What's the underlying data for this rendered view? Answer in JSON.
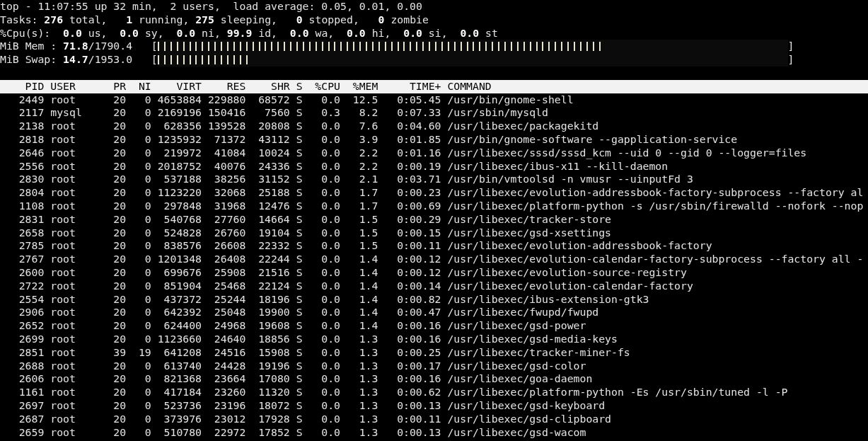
{
  "summary": {
    "uptime_line": "top - 11:07:55 up 32 min,  2 users,  load average: 0.05, 0.01, 0.00",
    "tasks_line": "Tasks: **276** total,   **1** running, **275** sleeping,   **0** stopped,   **0** zombie",
    "cpu_line": "%Cpu(s):  **0.0** us,  **0.0** sy,  **0.0** ni, **99.9** id,  **0.0** wa,  **0.0** hi,  **0.0** si,  **0.0** st",
    "meters": [
      {
        "label": "MiB Mem : **71.8**/1790.4",
        "open": "[",
        "close": "]",
        "level": 0.71
      },
      {
        "label": "MiB Swap: **14.7**/1953.0",
        "open": "[",
        "close": "]",
        "level": 0.15
      }
    ]
  },
  "table": {
    "columns": [
      "PID",
      "USER",
      "PR",
      "NI",
      "VIRT",
      "RES",
      "SHR",
      "S",
      "%CPU",
      "%MEM",
      "TIME+",
      "COMMAND"
    ],
    "rows": [
      [
        "2449",
        "root",
        "20",
        "0",
        "4653884",
        "229880",
        "68572",
        "S",
        "0.0",
        "12.5",
        "0:05.45",
        "/usr/bin/gnome-shell"
      ],
      [
        "2117",
        "mysql",
        "20",
        "0",
        "2169196",
        "150416",
        "7560",
        "S",
        "0.3",
        "8.2",
        "0:07.33",
        "/usr/sbin/mysqld"
      ],
      [
        "2138",
        "root",
        "20",
        "0",
        "628356",
        "139528",
        "20808",
        "S",
        "0.0",
        "7.6",
        "0:04.60",
        "/usr/libexec/packagekitd"
      ],
      [
        "2818",
        "root",
        "20",
        "0",
        "1235932",
        "71372",
        "43112",
        "S",
        "0.0",
        "3.9",
        "0:01.85",
        "/usr/bin/gnome-software --gapplication-service"
      ],
      [
        "2646",
        "root",
        "20",
        "0",
        "219972",
        "41084",
        "10024",
        "S",
        "0.0",
        "2.2",
        "0:01.16",
        "/usr/libexec/sssd/sssd_kcm --uid 0 --gid 0 --logger=files"
      ],
      [
        "2556",
        "root",
        "20",
        "0",
        "2018752",
        "40076",
        "24336",
        "S",
        "0.0",
        "2.2",
        "0:00.19",
        "/usr/libexec/ibus-x11 --kill-daemon"
      ],
      [
        "2830",
        "root",
        "20",
        "0",
        "537188",
        "38256",
        "31152",
        "S",
        "0.0",
        "2.1",
        "0:03.71",
        "/usr/bin/vmtoolsd -n vmusr --uinputFd 3"
      ],
      [
        "2804",
        "root",
        "20",
        "0",
        "1123220",
        "32068",
        "25188",
        "S",
        "0.0",
        "1.7",
        "0:00.23",
        "/usr/libexec/evolution-addressbook-factory-subprocess --factory al"
      ],
      [
        "1108",
        "root",
        "20",
        "0",
        "297848",
        "31968",
        "12476",
        "S",
        "0.0",
        "1.7",
        "0:00.69",
        "/usr/libexec/platform-python -s /usr/sbin/firewalld --nofork --nop"
      ],
      [
        "2831",
        "root",
        "20",
        "0",
        "540768",
        "27760",
        "14664",
        "S",
        "0.0",
        "1.5",
        "0:00.29",
        "/usr/libexec/tracker-store"
      ],
      [
        "2658",
        "root",
        "20",
        "0",
        "524828",
        "26760",
        "19104",
        "S",
        "0.0",
        "1.5",
        "0:00.15",
        "/usr/libexec/gsd-xsettings"
      ],
      [
        "2785",
        "root",
        "20",
        "0",
        "838576",
        "26608",
        "22332",
        "S",
        "0.0",
        "1.5",
        "0:00.11",
        "/usr/libexec/evolution-addressbook-factory"
      ],
      [
        "2767",
        "root",
        "20",
        "0",
        "1201348",
        "26408",
        "22244",
        "S",
        "0.0",
        "1.4",
        "0:00.12",
        "/usr/libexec/evolution-calendar-factory-subprocess --factory all -"
      ],
      [
        "2600",
        "root",
        "20",
        "0",
        "699676",
        "25908",
        "21516",
        "S",
        "0.0",
        "1.4",
        "0:00.12",
        "/usr/libexec/evolution-source-registry"
      ],
      [
        "2722",
        "root",
        "20",
        "0",
        "851904",
        "25468",
        "22124",
        "S",
        "0.0",
        "1.4",
        "0:00.14",
        "/usr/libexec/evolution-calendar-factory"
      ],
      [
        "2554",
        "root",
        "20",
        "0",
        "437372",
        "25244",
        "18196",
        "S",
        "0.0",
        "1.4",
        "0:00.82",
        "/usr/libexec/ibus-extension-gtk3"
      ],
      [
        "2906",
        "root",
        "20",
        "0",
        "642392",
        "25048",
        "19900",
        "S",
        "0.0",
        "1.4",
        "0:00.47",
        "/usr/libexec/fwupd/fwupd"
      ],
      [
        "2652",
        "root",
        "20",
        "0",
        "624400",
        "24968",
        "19608",
        "S",
        "0.0",
        "1.4",
        "0:00.16",
        "/usr/libexec/gsd-power"
      ],
      [
        "2699",
        "root",
        "20",
        "0",
        "1123660",
        "24640",
        "18856",
        "S",
        "0.0",
        "1.3",
        "0:00.16",
        "/usr/libexec/gsd-media-keys"
      ],
      [
        "2851",
        "root",
        "39",
        "19",
        "641208",
        "24516",
        "15908",
        "S",
        "0.0",
        "1.3",
        "0:00.25",
        "/usr/libexec/tracker-miner-fs"
      ],
      [
        "2688",
        "root",
        "20",
        "0",
        "613740",
        "24428",
        "19196",
        "S",
        "0.0",
        "1.3",
        "0:00.17",
        "/usr/libexec/gsd-color"
      ],
      [
        "2606",
        "root",
        "20",
        "0",
        "821368",
        "23664",
        "17080",
        "S",
        "0.0",
        "1.3",
        "0:00.16",
        "/usr/libexec/goa-daemon"
      ],
      [
        "1161",
        "root",
        "20",
        "0",
        "417184",
        "23260",
        "11320",
        "S",
        "0.0",
        "1.3",
        "0:00.62",
        "/usr/libexec/platform-python -Es /usr/sbin/tuned -l -P"
      ],
      [
        "2697",
        "root",
        "20",
        "0",
        "523736",
        "23196",
        "18072",
        "S",
        "0.0",
        "1.3",
        "0:00.13",
        "/usr/libexec/gsd-keyboard"
      ],
      [
        "2687",
        "root",
        "20",
        "0",
        "373976",
        "23012",
        "17928",
        "S",
        "0.0",
        "1.3",
        "0:00.11",
        "/usr/libexec/gsd-clipboard"
      ],
      [
        "2659",
        "root",
        "20",
        "0",
        "510780",
        "22972",
        "17852",
        "S",
        "0.0",
        "1.3",
        "0:00.13",
        "/usr/libexec/gsd-wacom"
      ]
    ]
  }
}
